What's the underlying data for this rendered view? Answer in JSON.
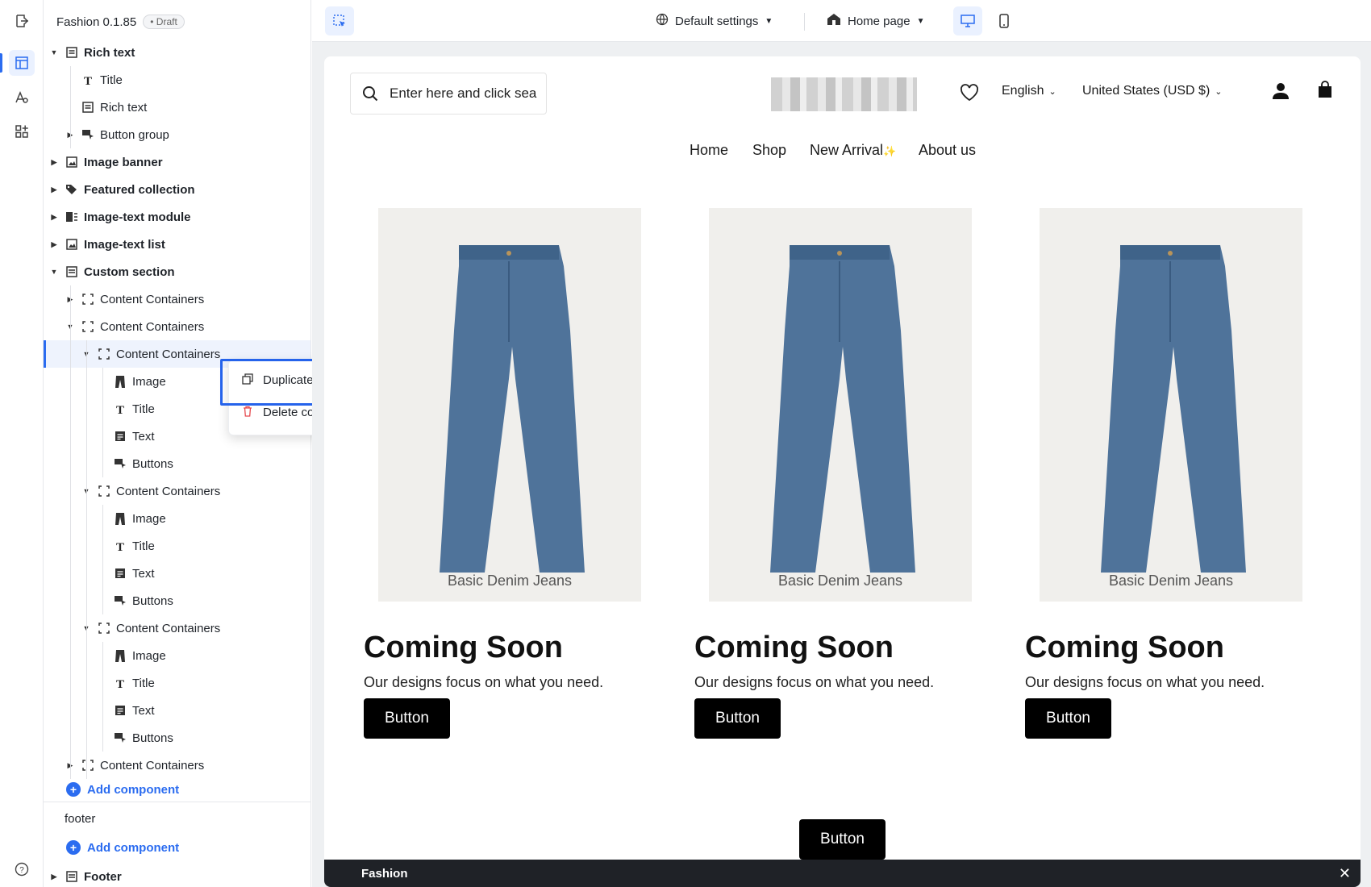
{
  "app": {
    "title": "Fashion 0.1.85",
    "status": "• Draft"
  },
  "rail": {
    "icons": [
      "exit-icon",
      "layout-icon",
      "typography-icon",
      "apps-icon",
      "help-icon"
    ]
  },
  "tree": [
    {
      "label": "Rich text",
      "icon": "richtext-icon",
      "level": 0,
      "caret": "▼",
      "bold": true
    },
    {
      "label": "Title",
      "icon": "title-icon",
      "level": 1,
      "caret": "",
      "bold": false
    },
    {
      "label": "Rich text",
      "icon": "richtext-icon",
      "level": 1,
      "caret": "",
      "bold": false
    },
    {
      "label": "Button group",
      "icon": "button-group-icon",
      "level": 1,
      "caret": "▶",
      "bold": false
    },
    {
      "label": "Image banner",
      "icon": "image-icon",
      "level": 0,
      "caret": "▶",
      "bold": true
    },
    {
      "label": "Featured collection",
      "icon": "tag-icon",
      "level": 0,
      "caret": "▶",
      "bold": true
    },
    {
      "label": "Image-text module",
      "icon": "image-text-icon",
      "level": 0,
      "caret": "▶",
      "bold": true
    },
    {
      "label": "Image-text list",
      "icon": "image-icon",
      "level": 0,
      "caret": "▶",
      "bold": true
    },
    {
      "label": "Custom section",
      "icon": "section-icon",
      "level": 0,
      "caret": "▼",
      "bold": true
    },
    {
      "label": "Content Containers",
      "icon": "container-icon",
      "level": 1,
      "caret": "▶",
      "bold": false
    },
    {
      "label": "Content Containers",
      "icon": "container-icon",
      "level": 1,
      "caret": "▼",
      "bold": false
    },
    {
      "label": "Content Containers",
      "icon": "container-icon",
      "level": 2,
      "caret": "▼",
      "bold": false,
      "selected": true
    },
    {
      "label": "Image",
      "icon": "jeans-icon",
      "level": 3,
      "caret": "",
      "bold": false
    },
    {
      "label": "Title",
      "icon": "title-icon",
      "level": 3,
      "caret": "",
      "bold": false
    },
    {
      "label": "Text",
      "icon": "text-icon",
      "level": 3,
      "caret": "",
      "bold": false
    },
    {
      "label": "Buttons",
      "icon": "buttons-icon",
      "level": 3,
      "caret": "",
      "bold": false
    },
    {
      "label": "Content Containers",
      "icon": "container-icon",
      "level": 2,
      "caret": "▼",
      "bold": false
    },
    {
      "label": "Image",
      "icon": "jeans-icon",
      "level": 3,
      "caret": "",
      "bold": false
    },
    {
      "label": "Title",
      "icon": "title-icon",
      "level": 3,
      "caret": "",
      "bold": false
    },
    {
      "label": "Text",
      "icon": "text-icon",
      "level": 3,
      "caret": "",
      "bold": false
    },
    {
      "label": "Buttons",
      "icon": "buttons-icon",
      "level": 3,
      "caret": "",
      "bold": false
    },
    {
      "label": "Content Containers",
      "icon": "container-icon",
      "level": 2,
      "caret": "▼",
      "bold": false
    },
    {
      "label": "Image",
      "icon": "jeans-icon",
      "level": 3,
      "caret": "",
      "bold": false
    },
    {
      "label": "Title",
      "icon": "title-icon",
      "level": 3,
      "caret": "",
      "bold": false
    },
    {
      "label": "Text",
      "icon": "text-icon",
      "level": 3,
      "caret": "",
      "bold": false
    },
    {
      "label": "Buttons",
      "icon": "buttons-icon",
      "level": 3,
      "caret": "",
      "bold": false
    },
    {
      "label": "Content Containers",
      "icon": "container-icon",
      "level": 1,
      "caret": "▶",
      "bold": false
    }
  ],
  "add_component": "Add component",
  "footer_group": "footer",
  "footer_row": "Footer",
  "context_menu": {
    "duplicate": "Duplicate component",
    "delete": "Delete component"
  },
  "toolbar": {
    "settings": "Default settings",
    "page": "Home page"
  },
  "store": {
    "search_placeholder": "Enter here and click sea",
    "wishlist_icon": "heart-icon",
    "language": "English",
    "currency": "United States (USD $)",
    "nav": [
      "Home",
      "Shop",
      "New Arrival",
      "About us"
    ],
    "new_arrival_sparkle": "✨",
    "cards": [
      {
        "image_label": "Basic Denim Jeans",
        "title": "Coming Soon",
        "desc": "Our designs focus on what you need.",
        "button": "Button"
      },
      {
        "image_label": "Basic Denim Jeans",
        "title": "Coming Soon",
        "desc": "Our designs focus on what you need.",
        "button": "Button"
      },
      {
        "image_label": "Basic Denim Jeans",
        "title": "Coming Soon",
        "desc": "Our designs focus on what you need.",
        "button": "Button"
      }
    ],
    "bottom_button": "Button",
    "bar_label": "Fashion"
  },
  "colors": {
    "accent": "#2b6cf0",
    "highlight": "#2563eb",
    "bar": "#1f2227"
  }
}
